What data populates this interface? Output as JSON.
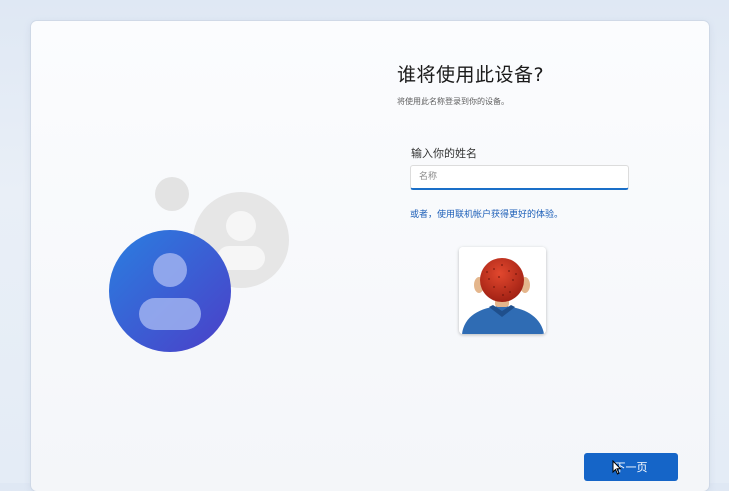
{
  "page": {
    "title": "谁将使用此设备?",
    "subtitle": "将使用此名称登录到你的设备。"
  },
  "form": {
    "name_label": "输入你的姓名",
    "name_placeholder": "名称",
    "name_value": "",
    "online_account_link": "或者，使用联机帐户获得更好的体验。"
  },
  "footer": {
    "next_label": "下一页"
  },
  "icons": {
    "illustration": "user-accounts-illustration",
    "profile": "user-profile-picture",
    "cursor": "mouse-pointer-icon"
  },
  "colors": {
    "accent": "#1565c8",
    "link": "#1c5fb8",
    "avatar_blue": "#2f63d6"
  }
}
